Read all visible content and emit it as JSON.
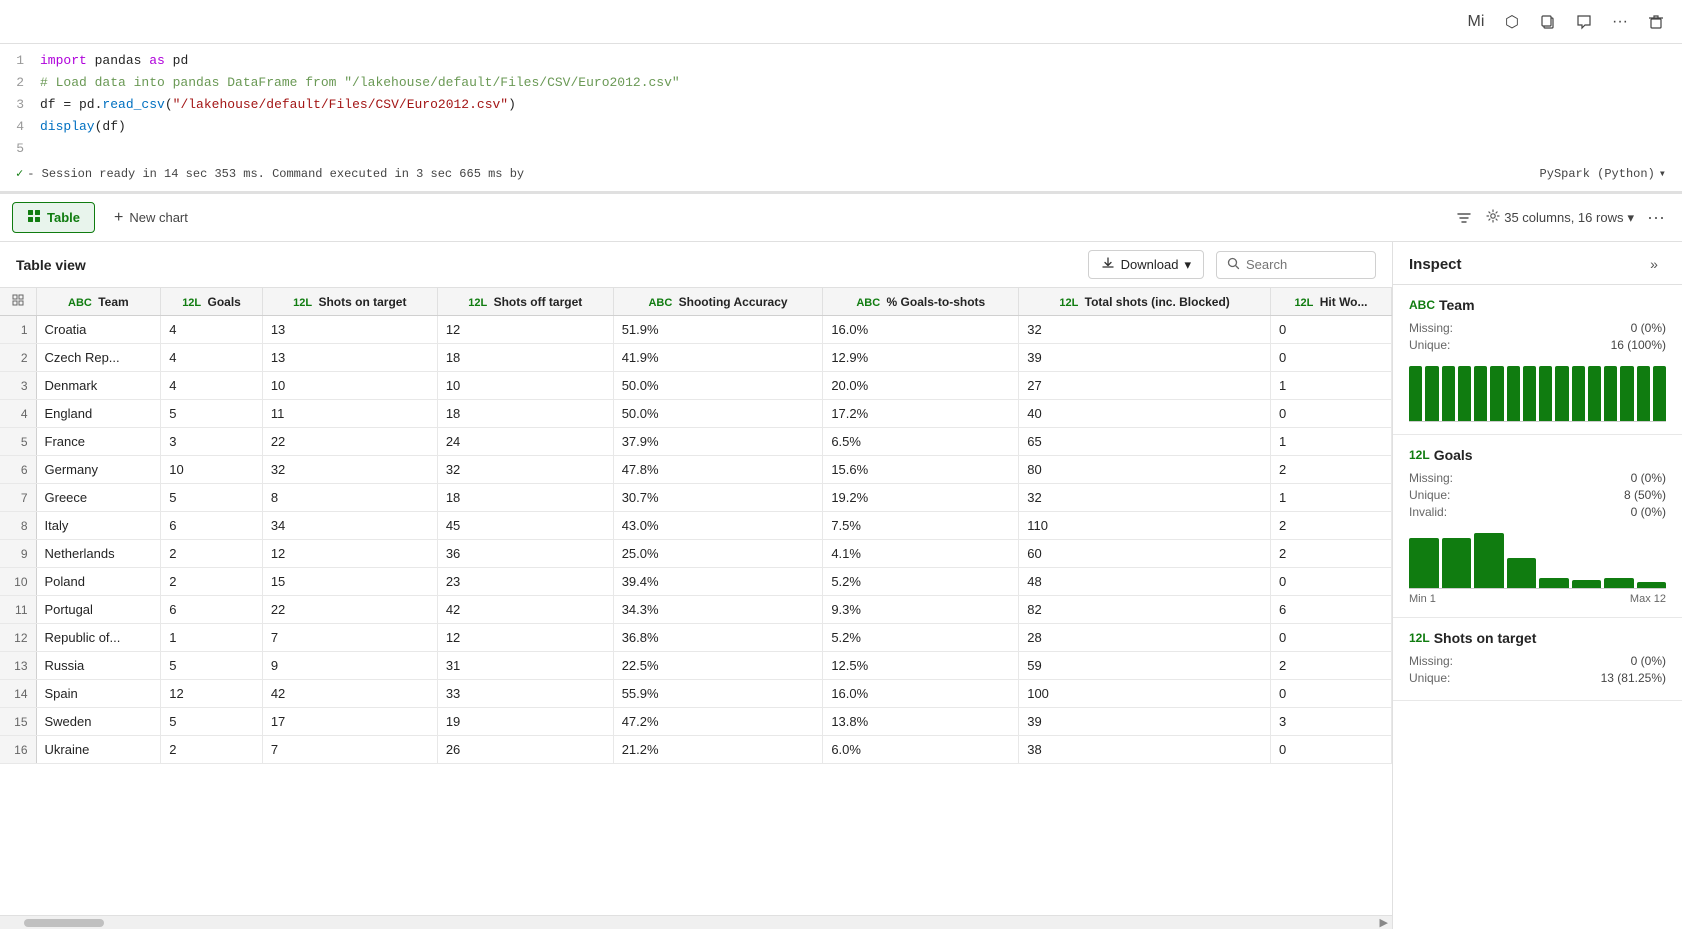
{
  "toolbar": {
    "icons": [
      "Mi",
      "□",
      "⧉",
      "💬",
      "···",
      "🗑"
    ]
  },
  "code": {
    "lines": [
      {
        "num": 1,
        "parts": [
          {
            "text": "import ",
            "cls": "kw"
          },
          {
            "text": "pandas ",
            "cls": ""
          },
          {
            "text": "as ",
            "cls": "kw"
          },
          {
            "text": "pd",
            "cls": ""
          }
        ]
      },
      {
        "num": 2,
        "parts": [
          {
            "text": "# Load data into pandas DataFrame from \"/lakehouse/default/Files/CSV/Euro2012.csv\"",
            "cls": "cm"
          }
        ]
      },
      {
        "num": 3,
        "parts": [
          {
            "text": "df",
            "cls": ""
          },
          {
            "text": " = ",
            "cls": ""
          },
          {
            "text": "pd",
            "cls": ""
          },
          {
            "text": ".",
            "cls": ""
          },
          {
            "text": "read_csv",
            "cls": "fn"
          },
          {
            "text": "(\"/lakehouse/default/Files/CSV/Euro2012.csv\")",
            "cls": "str"
          }
        ]
      },
      {
        "num": 4,
        "parts": [
          {
            "text": "display",
            "cls": "fn"
          },
          {
            "text": "(df)",
            "cls": ""
          }
        ]
      },
      {
        "num": 5,
        "parts": []
      }
    ],
    "status": "- Session ready in 14 sec 353 ms. Command executed in 3 sec 665 ms by",
    "lang": "PySpark (Python)"
  },
  "tabs": {
    "table_label": "Table",
    "new_chart_label": "New chart",
    "col_row_info": "35 columns, 16 rows"
  },
  "table_view": {
    "title": "Table view",
    "download_label": "Download",
    "search_placeholder": "Search",
    "columns": [
      {
        "type": "ABC",
        "name": "Team"
      },
      {
        "type": "12L",
        "name": "Goals"
      },
      {
        "type": "12L",
        "name": "Shots on target"
      },
      {
        "type": "12L",
        "name": "Shots off target"
      },
      {
        "type": "ABC",
        "name": "Shooting Accuracy"
      },
      {
        "type": "ABC",
        "name": "% Goals-to-shots"
      },
      {
        "type": "12L",
        "name": "Total shots (inc. Blocked)"
      },
      {
        "type": "12L",
        "name": "Hit Wo..."
      }
    ],
    "rows": [
      [
        1,
        "Croatia",
        4,
        13,
        12,
        "51.9%",
        "16.0%",
        32,
        0
      ],
      [
        2,
        "Czech Rep...",
        4,
        13,
        18,
        "41.9%",
        "12.9%",
        39,
        0
      ],
      [
        3,
        "Denmark",
        4,
        10,
        10,
        "50.0%",
        "20.0%",
        27,
        1
      ],
      [
        4,
        "England",
        5,
        11,
        18,
        "50.0%",
        "17.2%",
        40,
        0
      ],
      [
        5,
        "France",
        3,
        22,
        24,
        "37.9%",
        "6.5%",
        65,
        1
      ],
      [
        6,
        "Germany",
        10,
        32,
        32,
        "47.8%",
        "15.6%",
        80,
        2
      ],
      [
        7,
        "Greece",
        5,
        8,
        18,
        "30.7%",
        "19.2%",
        32,
        1
      ],
      [
        8,
        "Italy",
        6,
        34,
        45,
        "43.0%",
        "7.5%",
        110,
        2
      ],
      [
        9,
        "Netherlands",
        2,
        12,
        36,
        "25.0%",
        "4.1%",
        60,
        2
      ],
      [
        10,
        "Poland",
        2,
        15,
        23,
        "39.4%",
        "5.2%",
        48,
        0
      ],
      [
        11,
        "Portugal",
        6,
        22,
        42,
        "34.3%",
        "9.3%",
        82,
        6
      ],
      [
        12,
        "Republic of...",
        1,
        7,
        12,
        "36.8%",
        "5.2%",
        28,
        0
      ],
      [
        13,
        "Russia",
        5,
        9,
        31,
        "22.5%",
        "12.5%",
        59,
        2
      ],
      [
        14,
        "Spain",
        12,
        42,
        33,
        "55.9%",
        "16.0%",
        100,
        0
      ],
      [
        15,
        "Sweden",
        5,
        17,
        19,
        "47.2%",
        "13.8%",
        39,
        3
      ],
      [
        16,
        "Ukraine",
        2,
        7,
        26,
        "21.2%",
        "6.0%",
        38,
        0
      ]
    ]
  },
  "inspect": {
    "title": "Inspect",
    "close_label": "»",
    "sections": [
      {
        "col_name": "Team",
        "col_type": "ABC",
        "stats": [
          {
            "label": "Missing:",
            "value": "0 (0%)"
          },
          {
            "label": "Unique:",
            "value": "16 (100%)"
          }
        ],
        "chart_bars": [
          100,
          100,
          100,
          100,
          100,
          100,
          100,
          100,
          100,
          100,
          100,
          100,
          100,
          100,
          100,
          100
        ],
        "show_range": false
      },
      {
        "col_name": "Goals",
        "col_type": "12L",
        "stats": [
          {
            "label": "Missing:",
            "value": "0 (0%)"
          },
          {
            "label": "Unique:",
            "value": "8 (50%)"
          },
          {
            "label": "Invalid:",
            "value": "0 (0%)"
          }
        ],
        "chart_bars": [
          70,
          70,
          90,
          50,
          30,
          10,
          15,
          5
        ],
        "show_range": true,
        "range_min": "Min 1",
        "range_max": "Max 12"
      },
      {
        "col_name": "Shots on target",
        "col_type": "12L",
        "stats": [
          {
            "label": "Missing:",
            "value": "0 (0%)"
          },
          {
            "label": "Unique:",
            "value": "13 (81.25%)"
          }
        ],
        "chart_bars": [],
        "show_range": false
      }
    ]
  }
}
